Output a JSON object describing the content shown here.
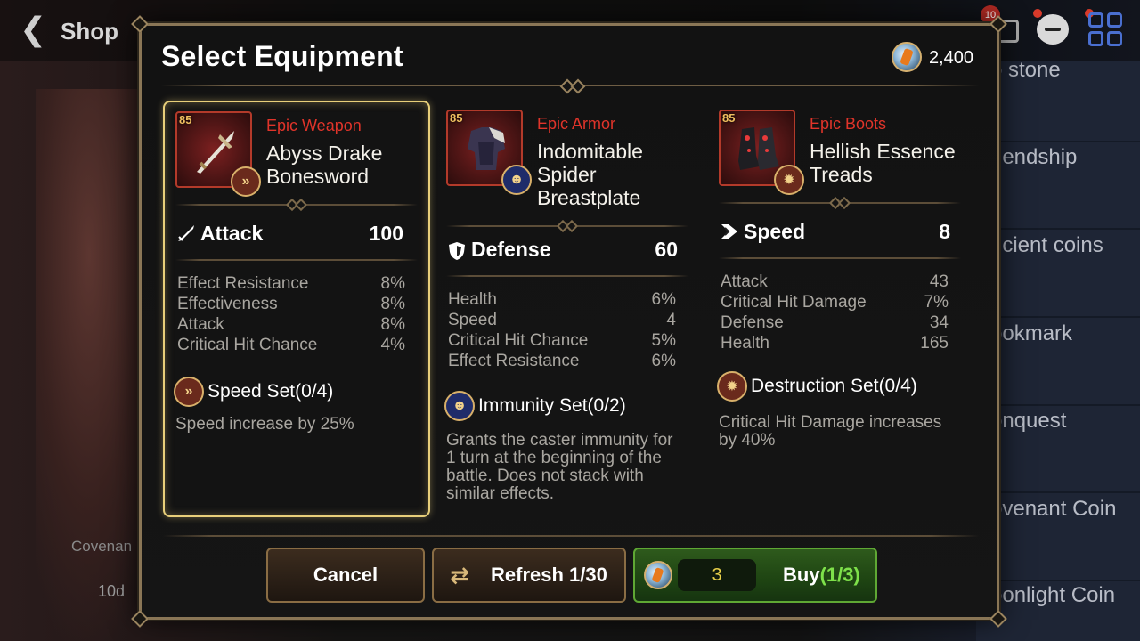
{
  "background": {
    "shop_title": "Shop",
    "mail_badge": "10",
    "shop_items": [
      "o stone",
      "riendship",
      "ncient coins",
      "ookmark",
      "onquest",
      "ovenant Coin",
      "oonlight Coin"
    ],
    "left_text_1": "Covenan",
    "left_text_2": "10d"
  },
  "modal": {
    "title": "Select Equipment",
    "currency_icon": "skystone-coin-icon",
    "currency_value": "2,400"
  },
  "cards": [
    {
      "level": "85",
      "rarity": "Epic Weapon",
      "name": "Abyss Drake Bonesword",
      "main_stat": {
        "name": "Attack",
        "value": "100",
        "icon": "sword-icon"
      },
      "substats": [
        {
          "name": "Effect Resistance",
          "value": "8%"
        },
        {
          "name": "Effectiveness",
          "value": "8%"
        },
        {
          "name": "Attack",
          "value": "8%"
        },
        {
          "name": "Critical Hit Chance",
          "value": "4%"
        }
      ],
      "set": {
        "name": "Speed Set(0/4)",
        "desc": "Speed increase by 25%",
        "icon": "speed-set-icon"
      }
    },
    {
      "level": "85",
      "rarity": "Epic Armor",
      "name": "Indomitable Spider Breastplate",
      "main_stat": {
        "name": "Defense",
        "value": "60",
        "icon": "shield-icon"
      },
      "substats": [
        {
          "name": "Health",
          "value": "6%"
        },
        {
          "name": "Speed",
          "value": "4"
        },
        {
          "name": "Critical Hit Chance",
          "value": "5%"
        },
        {
          "name": "Effect Resistance",
          "value": "6%"
        }
      ],
      "set": {
        "name": "Immunity Set(0/2)",
        "desc": "Grants the caster immunity for 1 turn at the beginning of the battle. Does not stack with similar effects.",
        "icon": "immunity-set-icon"
      }
    },
    {
      "level": "85",
      "rarity": "Epic Boots",
      "name": "Hellish Essence Treads",
      "main_stat": {
        "name": "Speed",
        "value": "8",
        "icon": "speed-icon"
      },
      "substats": [
        {
          "name": "Attack",
          "value": "43"
        },
        {
          "name": "Critical Hit Damage",
          "value": "7%"
        },
        {
          "name": "Defense",
          "value": "34"
        },
        {
          "name": "Health",
          "value": "165"
        }
      ],
      "set": {
        "name": "Destruction Set(0/4)",
        "desc": "Critical Hit Damage increases by 40%",
        "icon": "destruction-set-icon"
      }
    }
  ],
  "buttons": {
    "cancel": "Cancel",
    "refresh": "Refresh 1/30",
    "buy_price": "3",
    "buy_label": "Buy",
    "buy_count": "(1/3)"
  },
  "colors": {
    "rarity_epic": "#e0342a",
    "selected_border": "#e8cf7a",
    "buy_green": "#5fa834",
    "buy_count": "#7ee04a",
    "price": "#e8d04a"
  }
}
